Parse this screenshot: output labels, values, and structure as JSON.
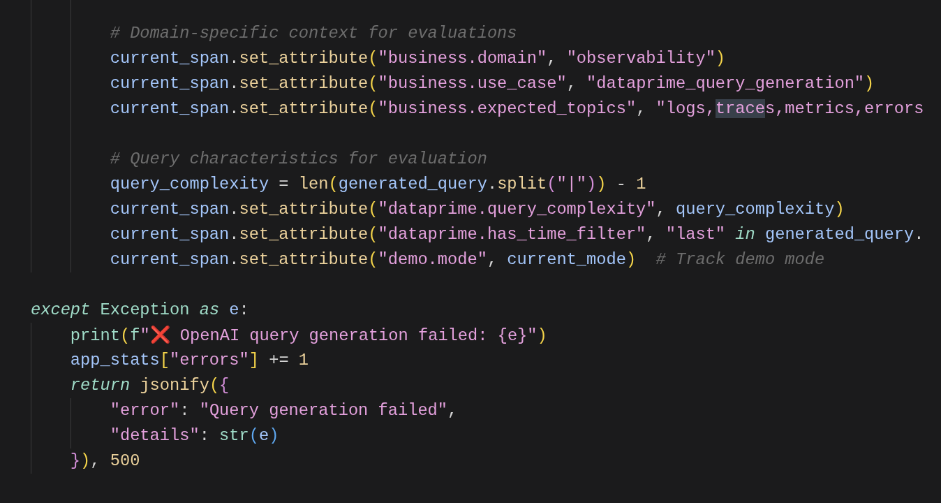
{
  "editor": {
    "lines": [
      {
        "kind": "blank"
      },
      {
        "kind": "code",
        "tokens": [
          {
            "kind": "comment",
            "text": "        # Domain-specific context for evaluations"
          }
        ]
      },
      {
        "kind": "code",
        "tokens": [
          {
            "kind": "var",
            "text": "        current_span"
          },
          {
            "kind": "punct",
            "text": "."
          },
          {
            "kind": "method",
            "text": "set_attribute"
          },
          {
            "kind": "bracket1",
            "text": "("
          },
          {
            "kind": "string",
            "text": "\"business.domain\""
          },
          {
            "kind": "punct",
            "text": ", "
          },
          {
            "kind": "string",
            "text": "\"observability\""
          },
          {
            "kind": "bracket1",
            "text": ")"
          }
        ]
      },
      {
        "kind": "code",
        "tokens": [
          {
            "kind": "var",
            "text": "        current_span"
          },
          {
            "kind": "punct",
            "text": "."
          },
          {
            "kind": "method",
            "text": "set_attribute"
          },
          {
            "kind": "bracket1",
            "text": "("
          },
          {
            "kind": "string",
            "text": "\"business.use_case\""
          },
          {
            "kind": "punct",
            "text": ", "
          },
          {
            "kind": "string",
            "text": "\"dataprime_query_generation\""
          },
          {
            "kind": "bracket1",
            "text": ")"
          }
        ]
      },
      {
        "kind": "code",
        "tokens": [
          {
            "kind": "var",
            "text": "        current_span"
          },
          {
            "kind": "punct",
            "text": "."
          },
          {
            "kind": "method",
            "text": "set_attribute"
          },
          {
            "kind": "bracket1",
            "text": "("
          },
          {
            "kind": "string",
            "text": "\"business.expected_topics\""
          },
          {
            "kind": "punct",
            "text": ", "
          },
          {
            "kind": "string",
            "text": "\"logs,"
          },
          {
            "kind": "match",
            "text": "trace"
          },
          {
            "kind": "string",
            "text": "s,metrics,errors"
          }
        ]
      },
      {
        "kind": "blank"
      },
      {
        "kind": "code",
        "tokens": [
          {
            "kind": "comment",
            "text": "        # Query characteristics for evaluation"
          }
        ]
      },
      {
        "kind": "code",
        "tokens": [
          {
            "kind": "var",
            "text": "        query_complexity"
          },
          {
            "kind": "punct",
            "text": " = "
          },
          {
            "kind": "method",
            "text": "len"
          },
          {
            "kind": "bracket1",
            "text": "("
          },
          {
            "kind": "var",
            "text": "generated_query"
          },
          {
            "kind": "punct",
            "text": "."
          },
          {
            "kind": "method",
            "text": "split"
          },
          {
            "kind": "bracket2",
            "text": "("
          },
          {
            "kind": "string",
            "text": "\"|\""
          },
          {
            "kind": "bracket2",
            "text": ")"
          },
          {
            "kind": "bracket1",
            "text": ")"
          },
          {
            "kind": "punct",
            "text": " - "
          },
          {
            "kind": "number",
            "text": "1"
          }
        ]
      },
      {
        "kind": "code",
        "tokens": [
          {
            "kind": "var",
            "text": "        current_span"
          },
          {
            "kind": "punct",
            "text": "."
          },
          {
            "kind": "method",
            "text": "set_attribute"
          },
          {
            "kind": "bracket1",
            "text": "("
          },
          {
            "kind": "string",
            "text": "\"dataprime.query_complexity\""
          },
          {
            "kind": "punct",
            "text": ", "
          },
          {
            "kind": "var",
            "text": "query_complexity"
          },
          {
            "kind": "bracket1",
            "text": ")"
          }
        ]
      },
      {
        "kind": "code",
        "tokens": [
          {
            "kind": "var",
            "text": "        current_span"
          },
          {
            "kind": "punct",
            "text": "."
          },
          {
            "kind": "method",
            "text": "set_attribute"
          },
          {
            "kind": "bracket1",
            "text": "("
          },
          {
            "kind": "string",
            "text": "\"dataprime.has_time_filter\""
          },
          {
            "kind": "punct",
            "text": ", "
          },
          {
            "kind": "string",
            "text": "\"last\" "
          },
          {
            "kind": "keyword",
            "text": "in"
          },
          {
            "kind": "var",
            "text": " generated_query"
          },
          {
            "kind": "punct",
            "text": "."
          }
        ]
      },
      {
        "kind": "code",
        "tokens": [
          {
            "kind": "var",
            "text": "        current_span"
          },
          {
            "kind": "punct",
            "text": "."
          },
          {
            "kind": "method",
            "text": "set_attribute"
          },
          {
            "kind": "bracket1",
            "text": "("
          },
          {
            "kind": "string",
            "text": "\"demo.mode\""
          },
          {
            "kind": "punct",
            "text": ", "
          },
          {
            "kind": "var",
            "text": "current_mode"
          },
          {
            "kind": "bracket1",
            "text": ")"
          },
          {
            "kind": "comment",
            "text": "  # Track demo mode"
          }
        ]
      },
      {
        "kind": "blank"
      },
      {
        "kind": "code",
        "tokens": [
          {
            "kind": "keyword",
            "text": "except "
          },
          {
            "kind": "class",
            "text": "Exception "
          },
          {
            "kind": "keyword",
            "text": "as "
          },
          {
            "kind": "var",
            "text": "e"
          },
          {
            "kind": "punct",
            "text": ":"
          }
        ]
      },
      {
        "kind": "code",
        "tokens": [
          {
            "kind": "builtin",
            "text": "    print"
          },
          {
            "kind": "bracket1",
            "text": "("
          },
          {
            "kind": "builtin",
            "text": "f"
          },
          {
            "kind": "string",
            "text": "\""
          },
          {
            "kind": "emoji",
            "text": "❌"
          },
          {
            "kind": "string",
            "text": " OpenAI query generation failed: {e}\""
          },
          {
            "kind": "bracket1",
            "text": ")"
          }
        ]
      },
      {
        "kind": "code",
        "tokens": [
          {
            "kind": "var",
            "text": "    app_stats"
          },
          {
            "kind": "bracket1",
            "text": "["
          },
          {
            "kind": "string",
            "text": "\"errors\""
          },
          {
            "kind": "bracket1",
            "text": "]"
          },
          {
            "kind": "punct",
            "text": " += "
          },
          {
            "kind": "number",
            "text": "1"
          }
        ]
      },
      {
        "kind": "code",
        "tokens": [
          {
            "kind": "keyword",
            "text": "    return "
          },
          {
            "kind": "method",
            "text": "jsonify"
          },
          {
            "kind": "bracket1",
            "text": "("
          },
          {
            "kind": "bracket2",
            "text": "{"
          }
        ]
      },
      {
        "kind": "code",
        "tokens": [
          {
            "kind": "string",
            "text": "        \"error\""
          },
          {
            "kind": "punct",
            "text": ": "
          },
          {
            "kind": "string",
            "text": "\"Query generation failed\""
          },
          {
            "kind": "punct",
            "text": ","
          }
        ]
      },
      {
        "kind": "code",
        "tokens": [
          {
            "kind": "string",
            "text": "        \"details\""
          },
          {
            "kind": "punct",
            "text": ": "
          },
          {
            "kind": "builtin",
            "text": "str"
          },
          {
            "kind": "bracket3",
            "text": "("
          },
          {
            "kind": "var",
            "text": "e"
          },
          {
            "kind": "bracket3",
            "text": ")"
          }
        ]
      },
      {
        "kind": "code",
        "tokens": [
          {
            "kind": "bracket2",
            "text": "    }"
          },
          {
            "kind": "bracket1",
            "text": ")"
          },
          {
            "kind": "punct",
            "text": ", "
          },
          {
            "kind": "number",
            "text": "500"
          }
        ]
      }
    ]
  }
}
